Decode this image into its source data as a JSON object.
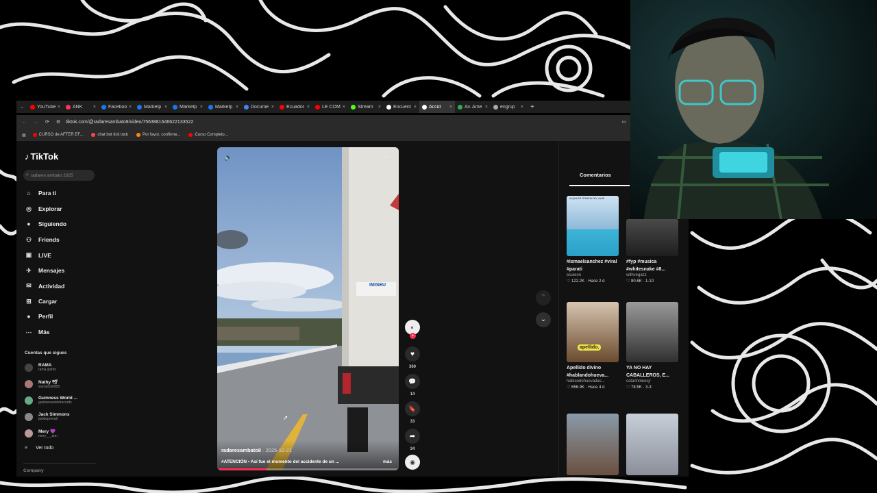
{
  "browser": {
    "tabs": [
      {
        "label": "YouTube",
        "color": "#ff0000"
      },
      {
        "label": "ANK",
        "color": "#ff3355"
      },
      {
        "label": "Faceboo",
        "color": "#1877f2"
      },
      {
        "label": "Marketp",
        "color": "#1877f2"
      },
      {
        "label": "Marketp",
        "color": "#1877f2"
      },
      {
        "label": "Marketp",
        "color": "#1877f2"
      },
      {
        "label": "Docume",
        "color": "#4285f4"
      },
      {
        "label": "Ecuador",
        "color": "#ff0000"
      },
      {
        "label": "LE COM",
        "color": "#ff0000"
      },
      {
        "label": "Stream",
        "color": "#53fc18"
      },
      {
        "label": "Encuent",
        "color": "#ffffff"
      },
      {
        "label": "Accid",
        "color": "#ffffff",
        "active": true
      },
      {
        "label": "Av. Ame",
        "color": "#34a853"
      },
      {
        "label": "engrup",
        "color": "#aaaaaa"
      }
    ],
    "url": "tiktok.com/@radaresambato8/video/7563881646622133522",
    "bookmarks": [
      {
        "label": "CURSO de AFTER EF...",
        "color": "#ff0000"
      },
      {
        "label": "chat bot tick tock",
        "color": "#ff4444"
      },
      {
        "label": "Por favor, confirme...",
        "color": "#ff8800"
      },
      {
        "label": "Curso Completo...",
        "color": "#ff0000"
      }
    ]
  },
  "tiktok": {
    "logo": "TikTok",
    "search_placeholder": "radares ambato 2025",
    "nav": [
      "Para ti",
      "Explorar",
      "Siguiendo",
      "Friends",
      "LIVE",
      "Mensajes",
      "Actividad",
      "Cargar",
      "Perfil",
      "Más"
    ],
    "following_title": "Cuentas que sigues",
    "following": [
      {
        "name": "RAMA",
        "handle": "rama.spirits"
      },
      {
        "name": "Nathy 🕊",
        "handle": "soynathy0905"
      },
      {
        "name": "Guinness World ...",
        "handle": "guinnessworldrecords"
      },
      {
        "name": "Jack Simmons",
        "handle": "jacktoprevail"
      },
      {
        "name": "Mery 💜",
        "handle": "mery___ann"
      }
    ],
    "see_all": "Ver todo",
    "company": "Company",
    "video": {
      "author": "radaresambato8",
      "date": "· 2025-10-21",
      "caption": "#ATENCIÓN ▪ Así fue el momento del accidente de un ...",
      "more": "más",
      "progress": 0.27,
      "truck_label": "IMISEU"
    },
    "actions": {
      "likes": "360",
      "comments": "14",
      "saves": "33",
      "shares": "34"
    },
    "right_tab": "Comentarios",
    "cards": [
      {
        "title": "#ismaelsanchez #viral #parati",
        "user": "eculeon",
        "meta": "122.2K · Hace 2 d",
        "thumb_text": "ALQUILER TERAPIA DEL VIAJE"
      },
      {
        "title": "#fyp #musica #whitesnake #8...",
        "user": "withvegazz",
        "meta": "80.6K · 1-10",
        "thumb_text": ""
      },
      {
        "title": "Apellido divino #hablandohueva...",
        "user": "hablandohuevadas...",
        "meta": "656.9K · Hace 4 d",
        "thumb_text": "apellido."
      },
      {
        "title": "YA NO HAY CABALLEROS, E...",
        "user": "catarinoleosjr",
        "meta": "78.5K · 3-3",
        "thumb_text": ""
      }
    ]
  }
}
